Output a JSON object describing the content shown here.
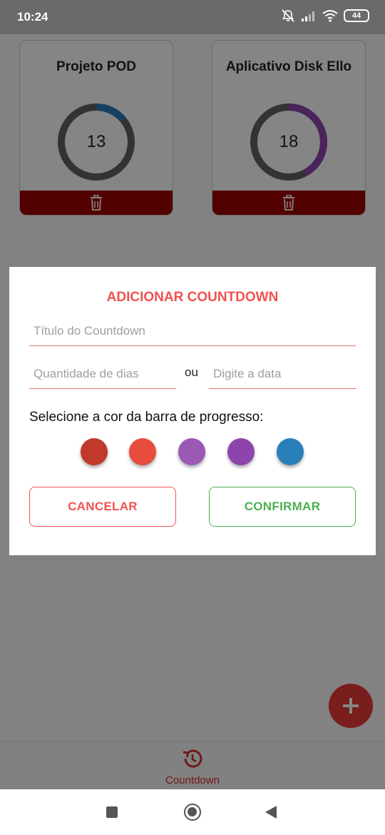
{
  "status_bar": {
    "time": "10:24",
    "battery": "44",
    "icons": [
      "notifications-off-icon",
      "signal-icon",
      "wifi-icon",
      "battery-icon"
    ]
  },
  "cards": [
    {
      "title": "Projeto POD",
      "count": "13",
      "progress": 0.14,
      "color": "#2a7ab9"
    },
    {
      "title": "Aplicativo Disk Ello",
      "count": "18",
      "progress": 0.42,
      "color": "#8e44ad"
    }
  ],
  "dialog": {
    "title": "ADICIONAR COUNTDOWN",
    "title_placeholder": "Título do Countdown",
    "days_placeholder": "Quantidade de dias",
    "or_label": "ou",
    "date_placeholder": "Digite a data",
    "color_prompt": "Selecione a cor da barra de progresso:",
    "colors": [
      "#c0392b",
      "#e74c3c",
      "#9b59b6",
      "#8e44ad",
      "#2980b9"
    ],
    "cancel_label": "CANCELAR",
    "confirm_label": "CONFIRMAR"
  },
  "bottom_nav": {
    "label": "Countdown",
    "icon": "history-icon"
  },
  "fab": {
    "icon": "plus-icon"
  },
  "accent_colors": {
    "delete_bar": "#9b0000",
    "fab": "#e53935",
    "cancel": "#ef5350",
    "confirm": "#4caf50"
  }
}
